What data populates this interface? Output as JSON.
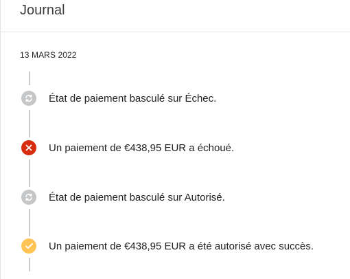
{
  "header": {
    "title": "Journal"
  },
  "timeline": {
    "date": "13 MARS 2022",
    "events": [
      {
        "text": "État de paiement basculé sur Échec.",
        "icon": "sync-icon",
        "color": "#c4c6c8"
      },
      {
        "text": "Un paiement de €438,95 EUR a échoué.",
        "icon": "close-icon",
        "color": "#d72c0d"
      },
      {
        "text": "État de paiement basculé sur Autorisé.",
        "icon": "sync-icon",
        "color": "#c4c6c8"
      },
      {
        "text": "Un paiement de €438,95 EUR a été autorisé avec succès.",
        "icon": "checkmark-icon",
        "color": "#ffc453"
      }
    ]
  },
  "colors": {
    "border": "#e1e3e5",
    "line": "#c9cccf",
    "text": "#202223"
  }
}
